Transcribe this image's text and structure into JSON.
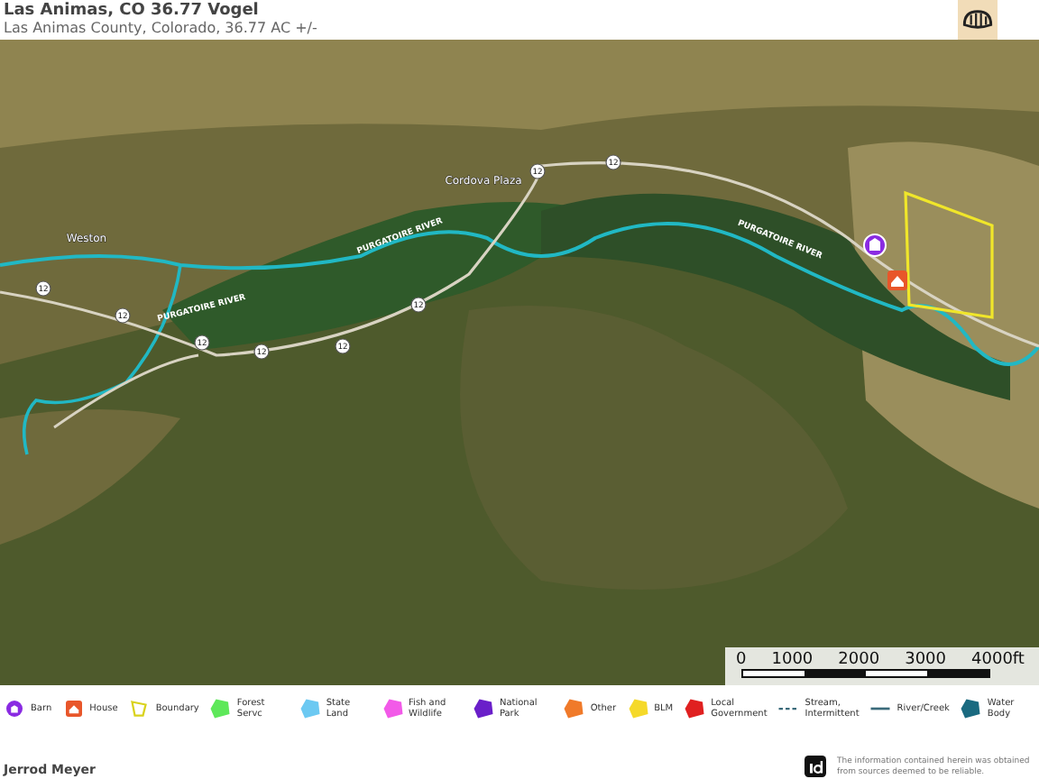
{
  "header": {
    "title": "Las Animas, CO 36.77 Vogel",
    "subtitle": "Las Animas County, Colorado, 36.77 AC +/-"
  },
  "map": {
    "place_labels": [
      "Weston",
      "Cordova Plaza"
    ],
    "river_labels": [
      "PURGATOIRE RIVER",
      "PURGATOIRE RIVER",
      "PURGATOIRE RIVER"
    ],
    "road_shields": [
      "12",
      "12",
      "12",
      "12",
      "12",
      "12",
      "12",
      "12"
    ],
    "scale_labels": [
      "0",
      "1000",
      "2000",
      "3000",
      "4000ft"
    ]
  },
  "legend": [
    {
      "label": "Barn",
      "kind": "barn",
      "color": "#8a2be2"
    },
    {
      "label": "House",
      "kind": "house",
      "color": "#e8562a"
    },
    {
      "label": "Boundary",
      "kind": "outline",
      "color": "#d9d21c"
    },
    {
      "label": "Forest Servc",
      "kind": "area",
      "color": "#5ee85a"
    },
    {
      "label": "State Land",
      "kind": "area",
      "color": "#6cc9f2"
    },
    {
      "label": "Fish and Wildlife",
      "kind": "area",
      "color": "#f25ae8"
    },
    {
      "label": "National Park",
      "kind": "area",
      "color": "#6a1fc9"
    },
    {
      "label": "Other",
      "kind": "area",
      "color": "#f07a2a"
    },
    {
      "label": "BLM",
      "kind": "area",
      "color": "#f5d92a"
    },
    {
      "label": "Local Government",
      "kind": "area",
      "color": "#e02020"
    },
    {
      "label": "Stream, Intermittent",
      "kind": "dashed",
      "color": "#3a6a7a"
    },
    {
      "label": "River/Creek",
      "kind": "line",
      "color": "#3a6a7a"
    },
    {
      "label": "Water Body",
      "kind": "area",
      "color": "#1a6a80"
    }
  ],
  "footer": {
    "agent": "Jerrod Meyer",
    "disclaimer": "The information contained herein was obtained from sources deemed to be reliable."
  }
}
